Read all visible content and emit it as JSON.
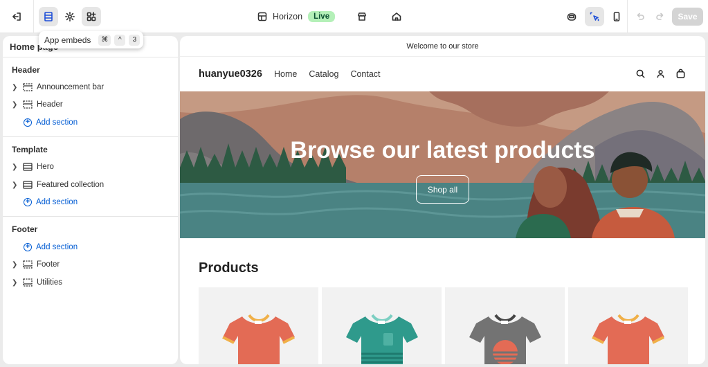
{
  "topbar": {
    "exit_icon": "exit-icon",
    "sections_icon": "sections-icon",
    "settings_icon": "gear-icon",
    "app_embeds_icon": "app-embeds-icon",
    "theme_name": "Horizon",
    "theme_status": "Live",
    "save_label": "Save"
  },
  "tooltip": {
    "label": "App embeds",
    "keys": [
      "⌘",
      "^",
      "3"
    ]
  },
  "sidebar": {
    "title": "Home page",
    "groups": [
      {
        "title": "Header",
        "items": [
          "Announcement bar",
          "Header"
        ],
        "add_label": "Add section"
      },
      {
        "title": "Template",
        "items": [
          "Hero",
          "Featured collection"
        ],
        "add_label": "Add section"
      },
      {
        "title": "Footer",
        "add_label": "Add section",
        "items": [
          "Footer",
          "Utilities"
        ]
      }
    ]
  },
  "preview": {
    "announcement": "Welcome to our store",
    "brand": "huanyue0326",
    "nav": [
      "Home",
      "Catalog",
      "Contact"
    ],
    "hero_title": "Browse our latest products",
    "hero_button": "Shop all",
    "products_title": "Products"
  },
  "colors": {
    "accent": "#005bd3",
    "live_bg": "#b4f0b8",
    "save_disabled": "#d4d4d4"
  }
}
